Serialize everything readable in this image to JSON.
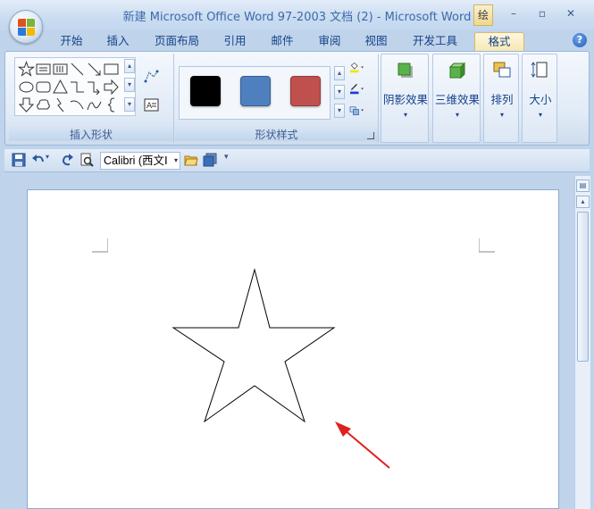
{
  "window": {
    "title": "新建 Microsoft Office Word 97-2003 文档 (2) - Microsoft Word",
    "context_label": "绘",
    "minimize": "–",
    "maximize": "▫",
    "close": "✕"
  },
  "tabs": [
    {
      "label": "开始"
    },
    {
      "label": "插入"
    },
    {
      "label": "页面布局"
    },
    {
      "label": "引用"
    },
    {
      "label": "邮件"
    },
    {
      "label": "审阅"
    },
    {
      "label": "视图"
    },
    {
      "label": "开发工具"
    },
    {
      "label": "格式",
      "active": true
    }
  ],
  "help": "?",
  "ribbon": {
    "insert_shapes_label": "插入形状",
    "shape_styles_label": "形状样式",
    "swatches": [
      "#000000",
      "#4e80bf",
      "#c0504d"
    ],
    "buttons": [
      {
        "label": "阴影效果",
        "icon": "shadow-effect-icon"
      },
      {
        "label": "三维效果",
        "icon": "3d-effect-icon"
      },
      {
        "label": "排列",
        "icon": "arrange-icon"
      },
      {
        "label": "大小",
        "icon": "size-icon"
      }
    ]
  },
  "qat": {
    "font_name": "Calibri (西文Ⅰ"
  },
  "colors": {
    "accent": "#15428b",
    "arrow": "#e02020",
    "star_stroke": "#000000"
  }
}
